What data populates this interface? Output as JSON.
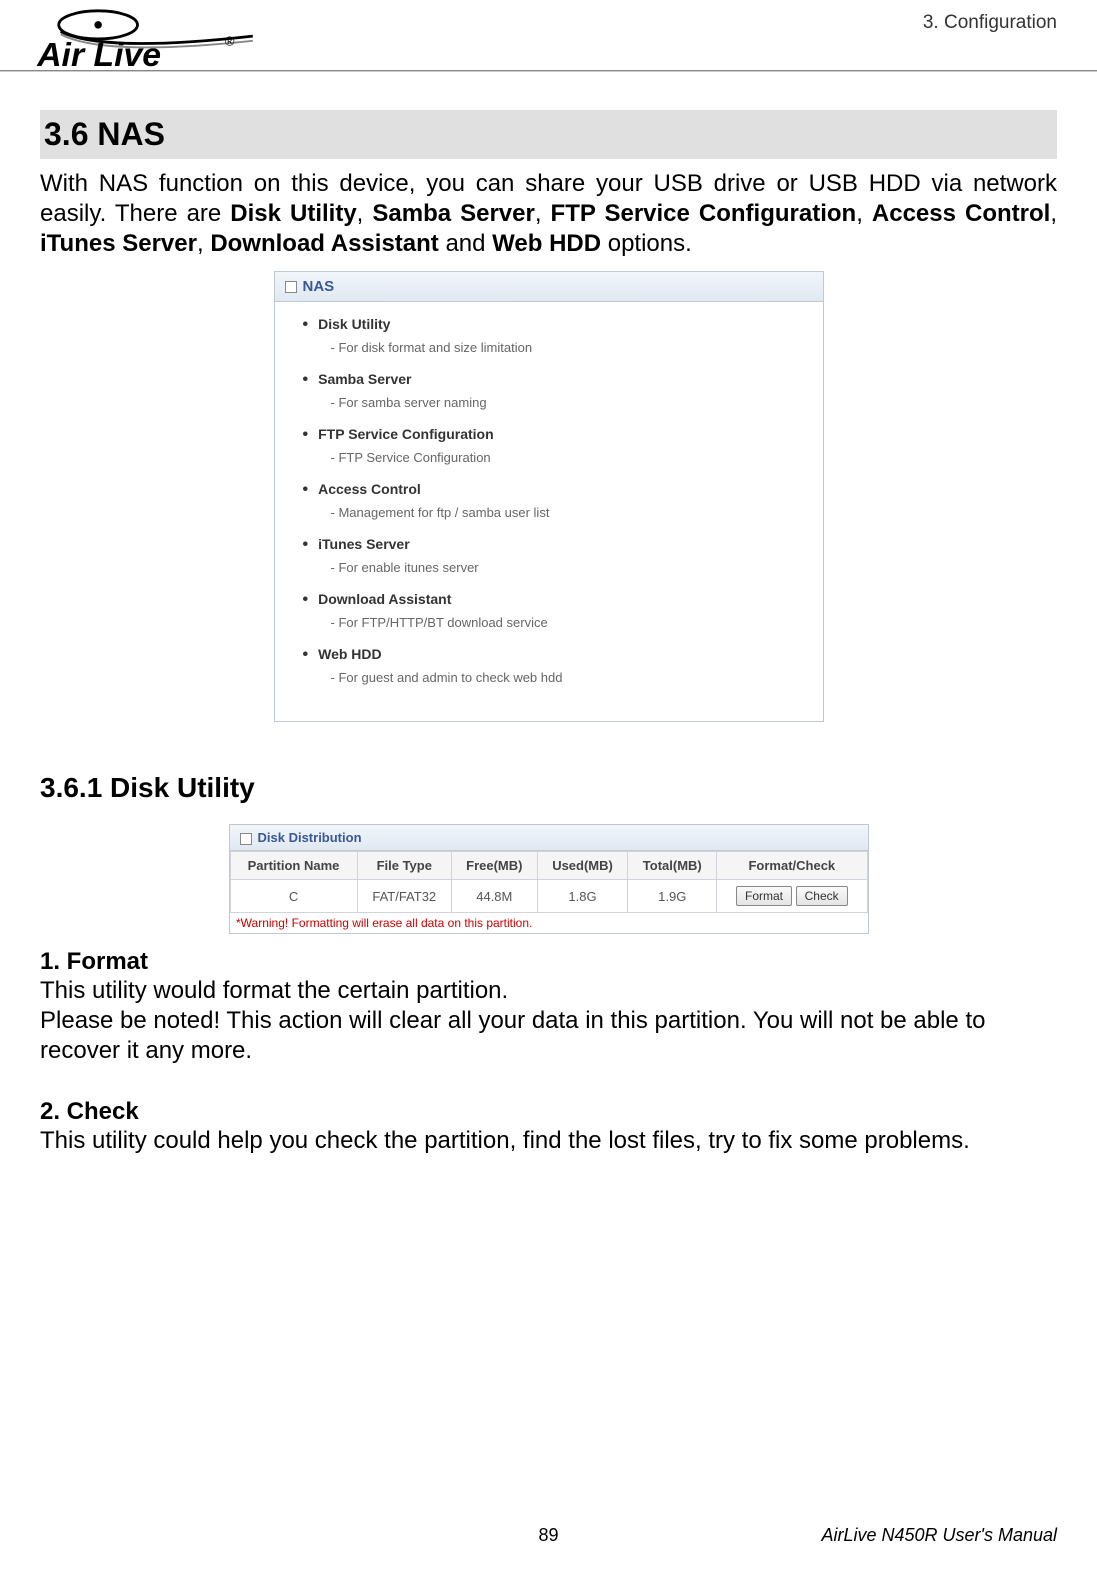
{
  "header": {
    "chapter": "3.  Configuration"
  },
  "logo": {
    "text": "Air Live",
    "tm": "®"
  },
  "section": {
    "title": "3.6 NAS",
    "intro_p1": "With NAS function on this device, you can share your USB drive or USB HDD via network easily. There are ",
    "b1": "Disk Utility",
    "c1": ", ",
    "b2": "Samba Server",
    "c2": ", ",
    "b3": "FTP Service Configuration",
    "c3": ", ",
    "b4": "Access Control",
    "c4": ", ",
    "b5": "iTunes Server",
    "c5": ", ",
    "b6": "Download Assistant",
    "c6": " and ",
    "b7": "Web HDD",
    "c7": " options."
  },
  "nas_panel": {
    "header": "NAS",
    "items": [
      {
        "title": "Disk Utility",
        "desc": "- For disk format and size limitation"
      },
      {
        "title": "Samba Server",
        "desc": "- For samba server naming"
      },
      {
        "title": "FTP Service Configuration",
        "desc": "- FTP Service Configuration"
      },
      {
        "title": "Access Control",
        "desc": "- Management for ftp / samba user list"
      },
      {
        "title": "iTunes Server",
        "desc": "- For enable itunes server"
      },
      {
        "title": "Download Assistant",
        "desc": "- For FTP/HTTP/BT download service"
      },
      {
        "title": "Web HDD",
        "desc": "- For guest and admin to check web hdd"
      }
    ]
  },
  "subsection": {
    "title": "3.6.1 Disk Utility"
  },
  "disk_panel": {
    "header": "Disk Distribution",
    "columns": [
      "Partition Name",
      "File Type",
      "Free(MB)",
      "Used(MB)",
      "Total(MB)",
      "Format/Check"
    ],
    "row": {
      "name": "C",
      "type": "FAT/FAT32",
      "free": "44.8M",
      "used": "1.8G",
      "total": "1.9G",
      "btn_format": "Format",
      "btn_check": "Check"
    },
    "warning": "*Warning! Formatting will erase all data on this partition."
  },
  "format_section": {
    "heading": "1.  Format",
    "line1": "This utility would format the certain partition.",
    "line2": "Please be noted! This action will clear all your data in this partition. You will not be able to recover it any more."
  },
  "check_section": {
    "heading": "2.  Check",
    "line1": "This utility could help you check the partition, find the lost files, try to fix some problems."
  },
  "footer": {
    "page": "89",
    "manual": "AirLive N450R User's Manual"
  }
}
